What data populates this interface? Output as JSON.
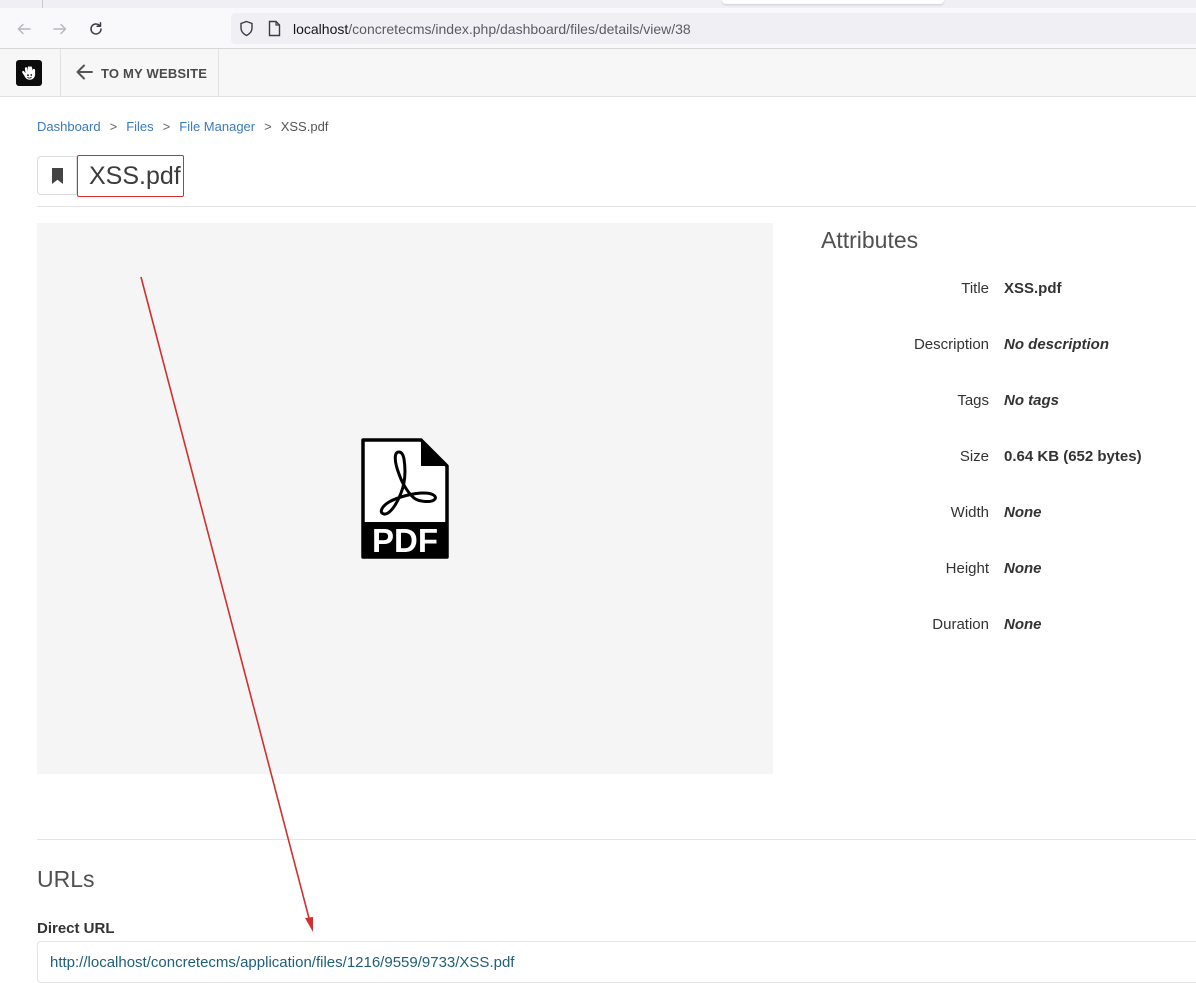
{
  "browser": {
    "url_host": "localhost",
    "url_path": "/concretecms/index.php/dashboard/files/details/view/38"
  },
  "toolbar": {
    "back_label": "TO MY WEBSITE"
  },
  "breadcrumb": {
    "items": [
      "Dashboard",
      "Files",
      "File Manager"
    ],
    "separator": ">",
    "current": "XSS.pdf"
  },
  "page_title": "XSS.pdf",
  "preview": {
    "icon": "pdf-file-icon",
    "icon_label": "PDF"
  },
  "attributes": {
    "heading": "Attributes",
    "rows": [
      {
        "label": "Title",
        "value": "XSS.pdf"
      },
      {
        "label": "Description",
        "value": "No description"
      },
      {
        "label": "Tags",
        "value": "No tags"
      },
      {
        "label": "Size",
        "value": "0.64 KB (652 bytes)"
      },
      {
        "label": "Width",
        "value": "None"
      },
      {
        "label": "Height",
        "value": "None"
      },
      {
        "label": "Duration",
        "value": "None"
      }
    ]
  },
  "urls": {
    "heading": "URLs",
    "direct_url_label": "Direct URL",
    "direct_url": "http://localhost/concretecms/application/files/1216/9559/9733/XSS.pdf"
  },
  "colors": {
    "link": "#3a7bbf",
    "annotation": "#d32f2f"
  }
}
